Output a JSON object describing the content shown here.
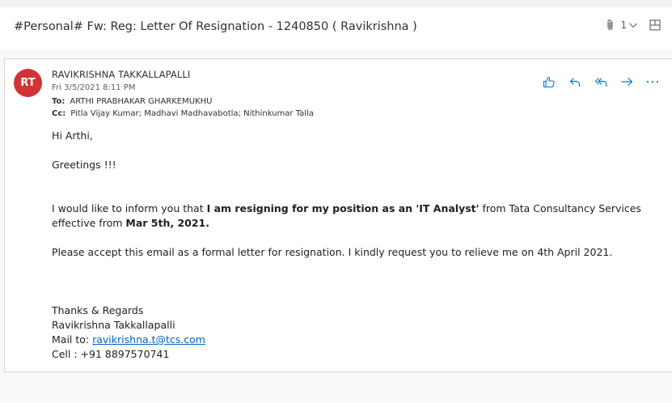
{
  "header": {
    "subject": "#Personal# Fw: Reg: Letter Of Resignation - 1240850 ( Ravikrishna )",
    "attachment_count": "1",
    "icons": [
      "paperclip-icon",
      "chevron-down-icon",
      "open-in-new-window-icon"
    ]
  },
  "message": {
    "avatar_initials": "RT",
    "avatar_color": "#d13438",
    "sender": "RAVIKRISHNA TAKKALLAPALLI",
    "date": "Fri 3/5/2021 8:11 PM",
    "to_label": "To:",
    "to": "ARTHI PRABHAKAR GHARKEMUKHU",
    "cc_label": "Cc:",
    "cc": "Pitla Vijay Kumar; Madhavi Madhavabotla; Nithinkumar Talla",
    "action_icons": [
      "like-icon",
      "reply-icon",
      "reply-all-icon",
      "forward-icon",
      "more-icon"
    ],
    "accent_color": "#0078d4"
  },
  "body": {
    "greeting": "Hi Arthi,",
    "greetings_line": "Greetings !!!",
    "para1_start": "I would like to inform you that ",
    "para1_bold": "I am resigning for my position as an 'IT Analyst'",
    "para1_mid": " from Tata Consultancy Services effective from ",
    "para1_date": "Mar 5th, 2021.",
    "para2": "Please accept this email as a formal letter for resignation. I kindly request you to relieve me on 4th April 2021.",
    "closing": "Thanks & Regards",
    "signature_name": "Ravikrishna Takkallapalli",
    "mail_label": "Mail to: ",
    "mail_link": "ravikrishna.t@tcs.com",
    "cell": "Cell : +91 8897570741"
  }
}
